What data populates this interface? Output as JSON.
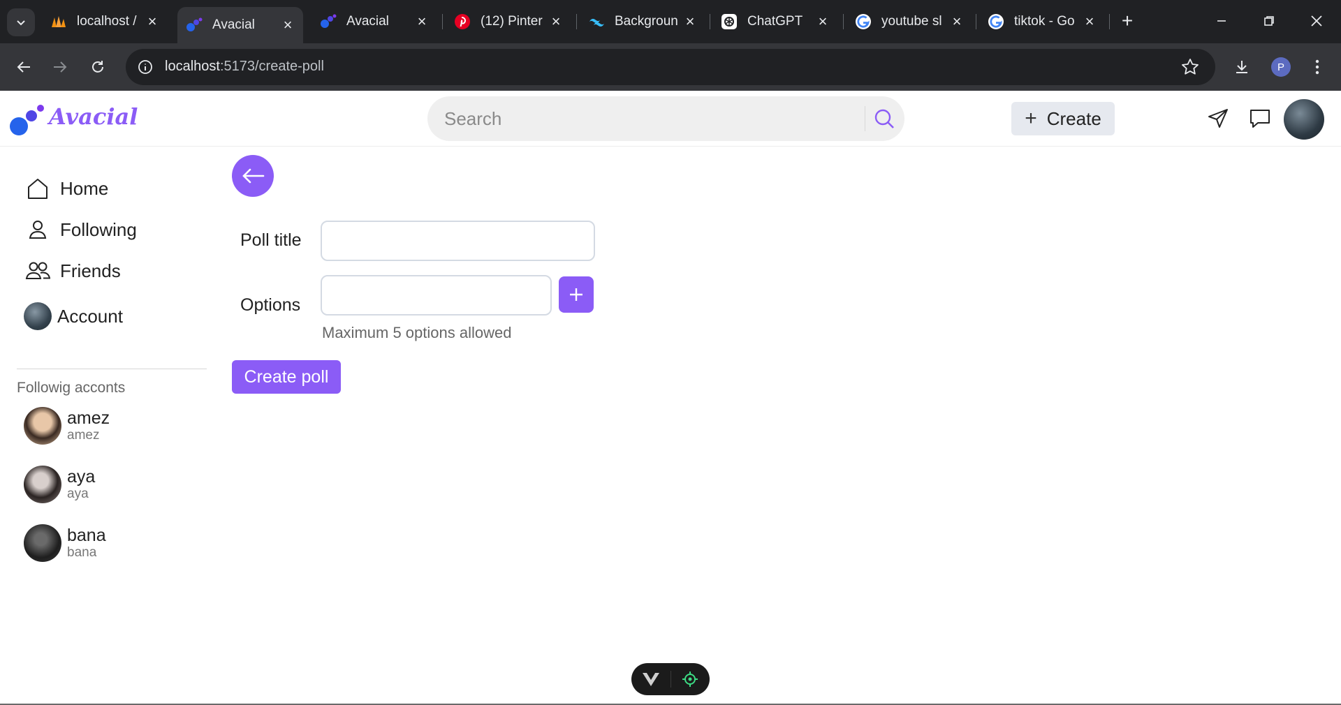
{
  "browser": {
    "tabs": [
      {
        "title": "localhost /",
        "favicon": "phpmyadmin-icon",
        "active": false
      },
      {
        "title": "Avacial",
        "favicon": "avacial-icon",
        "active": true
      },
      {
        "title": "Avacial",
        "favicon": "avacial-icon",
        "active": false
      },
      {
        "title": "(12) Pinter",
        "favicon": "pinterest-icon",
        "active": false
      },
      {
        "title": "Backgroun",
        "favicon": "tailwind-icon",
        "active": false
      },
      {
        "title": "ChatGPT",
        "favicon": "chatgpt-icon",
        "active": false
      },
      {
        "title": "youtube sl",
        "favicon": "google-icon",
        "active": false
      },
      {
        "title": "tiktok - Go",
        "favicon": "google-icon",
        "active": false
      }
    ],
    "url_host": "localhost",
    "url_path": ":5173/create-poll",
    "profile_initial": "P"
  },
  "header": {
    "brand": "Avacial",
    "search_placeholder": "Search",
    "create_label": "Create"
  },
  "sidebar": {
    "nav": [
      {
        "label": "Home",
        "icon": "home-icon"
      },
      {
        "label": "Following",
        "icon": "user-icon"
      },
      {
        "label": "Friends",
        "icon": "users-icon"
      },
      {
        "label": "Account",
        "icon": "avatar"
      }
    ],
    "section_title": "Followig acconts",
    "following": [
      {
        "name": "amez",
        "handle": "amez"
      },
      {
        "name": "aya",
        "handle": "aya"
      },
      {
        "name": "bana",
        "handle": "bana"
      }
    ]
  },
  "form": {
    "title_label": "Poll title",
    "title_value": "",
    "options_label": "Options",
    "option_value": "",
    "hint": "Maximum 5 options allowed",
    "submit_label": "Create poll"
  },
  "colors": {
    "accent": "#8b5cf6",
    "logo_blue": "#2563eb"
  }
}
